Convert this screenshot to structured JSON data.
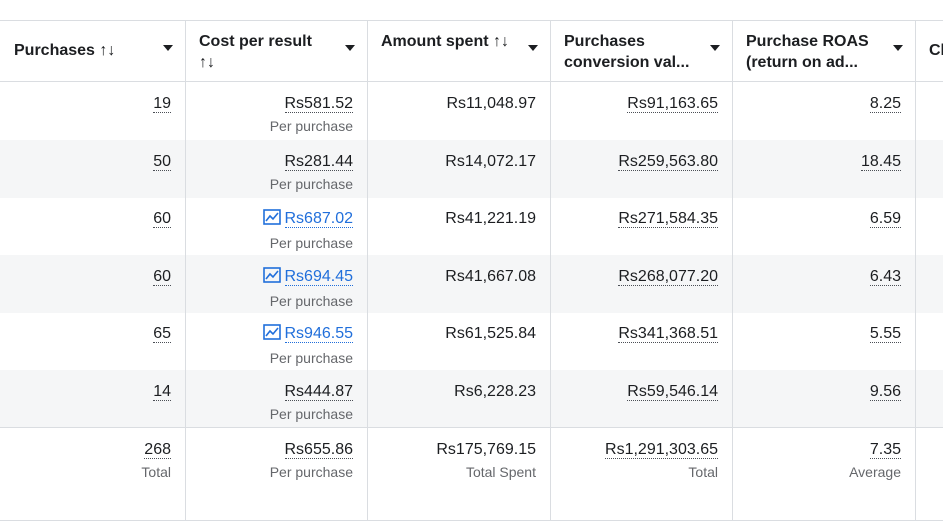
{
  "columns": [
    {
      "label": "Purchases ↑↓"
    },
    {
      "label": "Cost per result ↑↓"
    },
    {
      "label": "Amount spent ↑↓"
    },
    {
      "label": "Purchases conversion val..."
    },
    {
      "label": "Purchase ROAS (return on ad..."
    },
    {
      "label": "Cl"
    }
  ],
  "rows": [
    {
      "purchases": "19",
      "cost": "Rs581.52",
      "cost_sub": "Per purchase",
      "trend": false,
      "spent": "Rs11,048.97",
      "conv": "Rs91,163.65",
      "roas": "8.25"
    },
    {
      "purchases": "50",
      "cost": "Rs281.44",
      "cost_sub": "Per purchase",
      "trend": false,
      "spent": "Rs14,072.17",
      "conv": "Rs259,563.80",
      "roas": "18.45"
    },
    {
      "purchases": "60",
      "cost": "Rs687.02",
      "cost_sub": "Per purchase",
      "trend": true,
      "spent": "Rs41,221.19",
      "conv": "Rs271,584.35",
      "roas": "6.59"
    },
    {
      "purchases": "60",
      "cost": "Rs694.45",
      "cost_sub": "Per purchase",
      "trend": true,
      "spent": "Rs41,667.08",
      "conv": "Rs268,077.20",
      "roas": "6.43"
    },
    {
      "purchases": "65",
      "cost": "Rs946.55",
      "cost_sub": "Per purchase",
      "trend": true,
      "spent": "Rs61,525.84",
      "conv": "Rs341,368.51",
      "roas": "5.55"
    },
    {
      "purchases": "14",
      "cost": "Rs444.87",
      "cost_sub": "Per purchase",
      "trend": false,
      "spent": "Rs6,228.23",
      "conv": "Rs59,546.14",
      "roas": "9.56"
    }
  ],
  "totals": {
    "purchases": "268",
    "purchases_label": "Total",
    "cost": "Rs655.86",
    "cost_label": "Per purchase",
    "spent": "Rs175,769.15",
    "spent_label": "Total Spent",
    "conv": "Rs1,291,303.65",
    "conv_label": "Total",
    "roas": "7.35",
    "roas_label": "Average"
  },
  "icons": {
    "trend": "trend-chart-icon",
    "sort": "sort-caret-icon"
  },
  "colors": {
    "link": "#216fdb",
    "border": "#dadde1",
    "alt_row": "#f5f6f7"
  }
}
